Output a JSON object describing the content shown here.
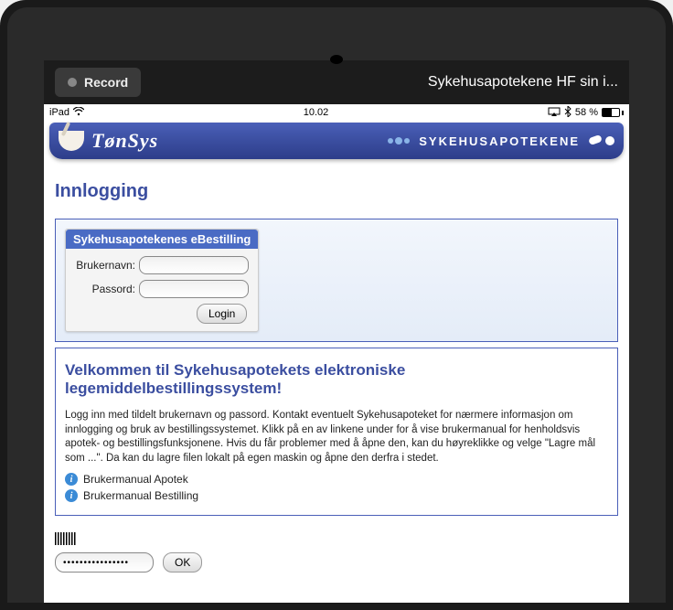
{
  "topBar": {
    "recordLabel": "Record",
    "title": "Sykehusapotekene HF sin i..."
  },
  "ipadStatus": {
    "device": "iPad",
    "wifiGlyph": "☰",
    "time": "10.02",
    "airplay": "▢",
    "bluetooth": "✵",
    "batteryPct": "58 %"
  },
  "banner": {
    "brand": "TønSys",
    "orgName": "SYKEHUSAPOTEKENE"
  },
  "page": {
    "title": "Innlogging"
  },
  "login": {
    "boxTitle": "Sykehusapotekenes eBestilling",
    "usernameLabel": "Brukernavn:",
    "passwordLabel": "Passord:",
    "usernameValue": "",
    "passwordValue": "",
    "loginButton": "Login"
  },
  "welcome": {
    "title": "Velkommen til Sykehusapotekets elektroniske legemiddelbestillingssystem!",
    "text": "Logg inn med tildelt  brukernavn og passord. Kontakt eventuelt Sykehusapoteket for nærmere informasjon om innlogging og bruk av bestillingssystemet. Klikk på en av linkene under for å vise brukermanual for henholdsvis apotek- og bestillingsfunksjonene. Hvis du får problemer med å åpne den, kan du høyreklikke og velge \"Lagre mål som ...\". Da kan du lagre filen lokalt på egen maskin og åpne den derfra i stedet.",
    "manual1": "Brukermanual Apotek",
    "manual2": "Brukermanual Bestilling"
  },
  "bottom": {
    "pinValue": "••••••••••••••••",
    "okLabel": "OK"
  }
}
